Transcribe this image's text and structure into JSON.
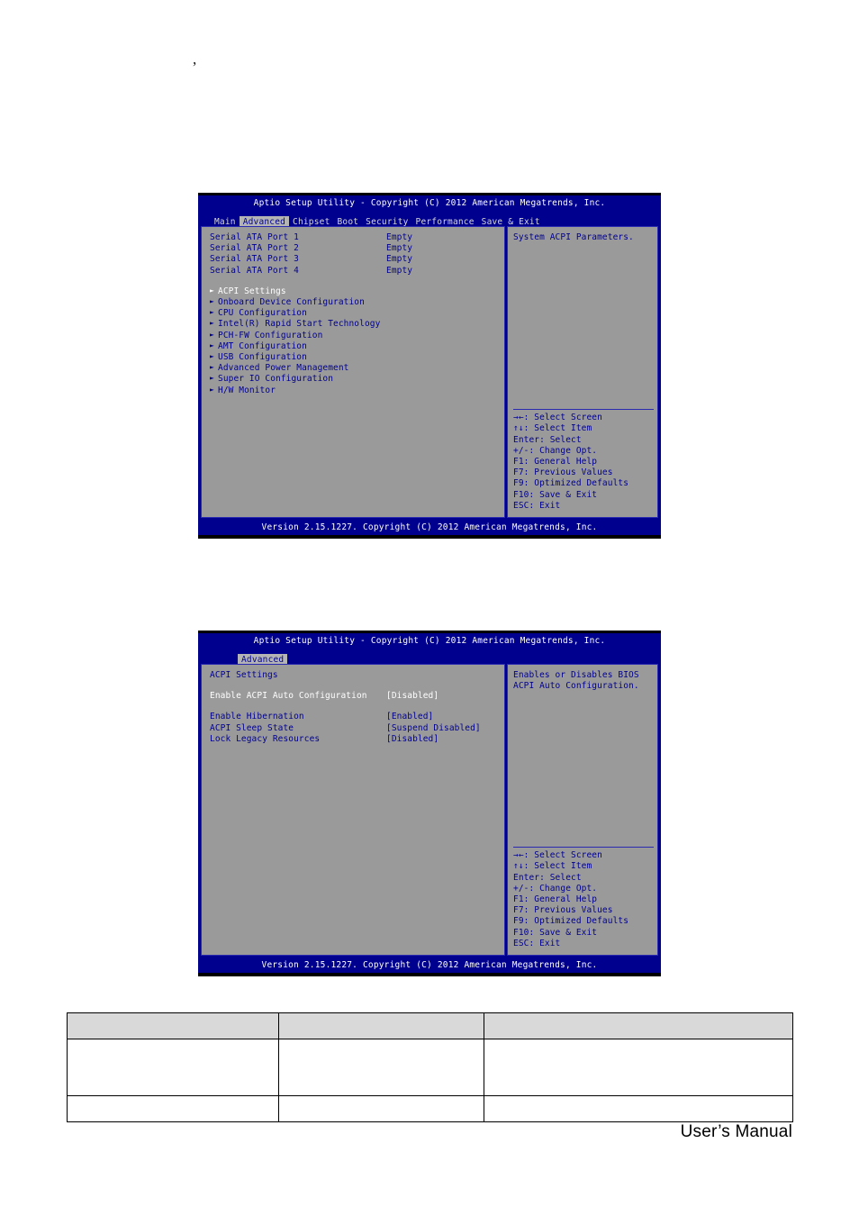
{
  "page": {
    "top_mark": ",",
    "footer_label": "User’s Manual"
  },
  "bios_screen_1": {
    "title": "Aptio Setup Utility - Copyright (C) 2012 American Megatrends, Inc.",
    "tabs": [
      {
        "label": "Main",
        "active": false
      },
      {
        "label": "Advanced",
        "active": true
      },
      {
        "label": "Chipset",
        "active": false
      },
      {
        "label": "Boot",
        "active": false
      },
      {
        "label": "Security",
        "active": false
      },
      {
        "label": "Performance",
        "active": false
      },
      {
        "label": "Save & Exit",
        "active": false
      }
    ],
    "rows": [
      {
        "label": "Serial ATA Port 1",
        "value": "Empty"
      },
      {
        "label": "Serial ATA Port 2",
        "value": "Empty"
      },
      {
        "label": "Serial ATA Port 3",
        "value": "Empty"
      },
      {
        "label": "Serial ATA Port 4",
        "value": "Empty"
      }
    ],
    "menu_items": [
      {
        "label": "ACPI Settings",
        "selected": true
      },
      {
        "label": "Onboard Device Configuration",
        "selected": false
      },
      {
        "label": "CPU Configuration",
        "selected": false
      },
      {
        "label": "Intel(R) Rapid Start Technology",
        "selected": false
      },
      {
        "label": "PCH-FW Configuration",
        "selected": false
      },
      {
        "label": "AMT Configuration",
        "selected": false
      },
      {
        "label": "USB Configuration",
        "selected": false
      },
      {
        "label": "Advanced Power Management",
        "selected": false
      },
      {
        "label": "Super IO Configuration",
        "selected": false
      },
      {
        "label": "H/W Monitor",
        "selected": false
      }
    ],
    "help_text": "System ACPI Parameters.",
    "keys": [
      "→←: Select Screen",
      "↑↓: Select Item",
      "Enter: Select",
      "+/-: Change Opt.",
      "F1: General Help",
      "F7: Previous Values",
      "F9: Optimized Defaults",
      "F10: Save & Exit",
      "ESC: Exit"
    ],
    "footer": "Version 2.15.1227. Copyright (C) 2012 American Megatrends, Inc."
  },
  "bios_screen_2": {
    "title": "Aptio Setup Utility - Copyright (C) 2012 American Megatrends, Inc.",
    "tabs": [
      {
        "label": "Advanced",
        "active": true
      }
    ],
    "section_heading": "ACPI Settings",
    "rows": [
      {
        "label": "Enable ACPI Auto Configuration",
        "value": "[Disabled]",
        "selected": true
      },
      {
        "label": "Enable Hibernation",
        "value": "[Enabled]",
        "selected": false
      },
      {
        "label": "ACPI Sleep State",
        "value": "[Suspend Disabled]",
        "selected": false
      },
      {
        "label": "Lock Legacy Resources",
        "value": "[Disabled]",
        "selected": false
      }
    ],
    "help_text": "Enables or Disables BIOS ACPI Auto Configuration.",
    "keys": [
      "→←: Select Screen",
      "↑↓: Select Item",
      "Enter: Select",
      "+/-: Change Opt.",
      "F1: General Help",
      "F7: Previous Values",
      "F9: Optimized Defaults",
      "F10: Save & Exit",
      "ESC: Exit"
    ],
    "footer": "Version 2.15.1227. Copyright (C) 2012 American Megatrends, Inc."
  },
  "spec_table": {
    "headers": [
      "",
      "",
      ""
    ],
    "rows": [
      {
        "cells": [
          "",
          "",
          ""
        ],
        "tall": true
      },
      {
        "cells": [
          "",
          "",
          ""
        ],
        "tall": false
      }
    ]
  }
}
